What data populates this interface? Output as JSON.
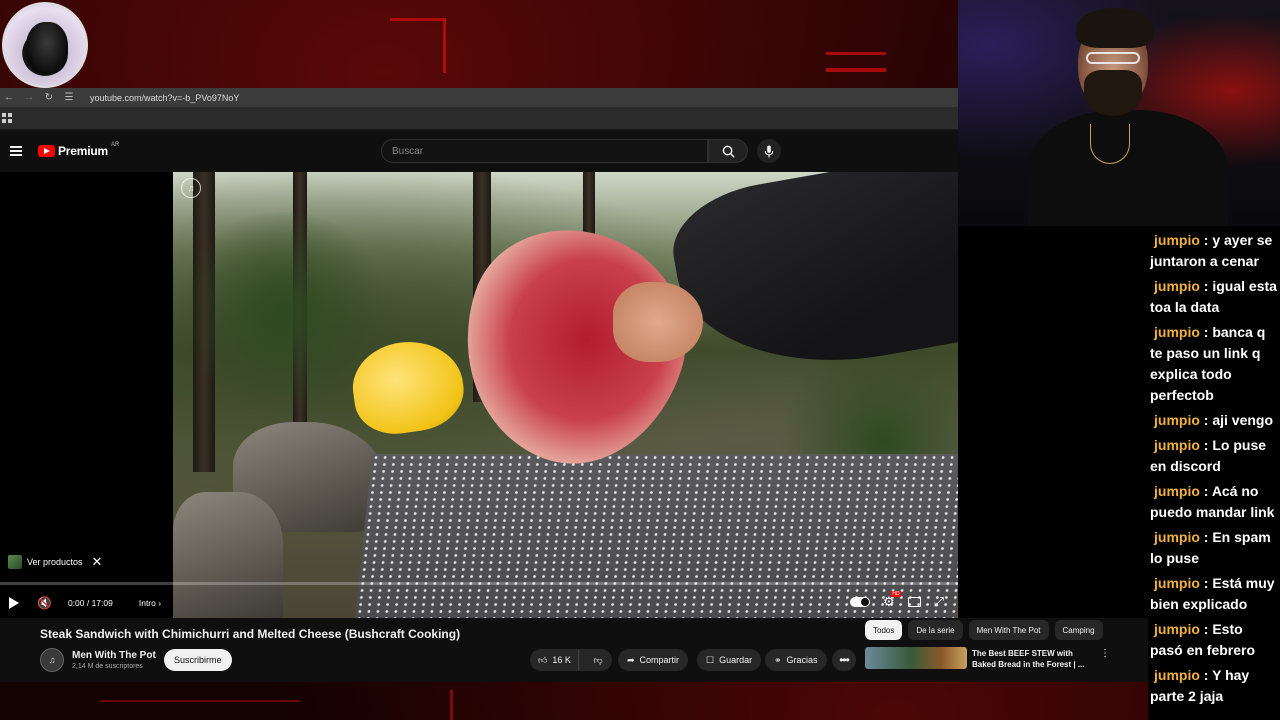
{
  "browser": {
    "url": "youtube.com/watch?v=-b_PVo97NoY"
  },
  "youtube": {
    "logo_text": "Premium",
    "region": "AR",
    "search_placeholder": "Buscar"
  },
  "player": {
    "products_label": "Ver productos",
    "time": "0:00 / 17:09",
    "chapter": "Intro",
    "progress": 0.0,
    "autoplay_on": true
  },
  "video": {
    "title": "Steak Sandwich with Chimichurri and Melted Cheese (Bushcraft Cooking)",
    "channel_name": "Men With The Pot",
    "subscribers": "2,14 M de suscriptores",
    "subscribe_label": "Suscribirme",
    "likes": "16 K",
    "share_label": "Compartir",
    "save_label": "Guardar",
    "thanks_label": "Gracias"
  },
  "recommendations": {
    "chips": [
      "Todos",
      "De la serie",
      "Men With The Pot",
      "Camping"
    ],
    "first_title": "The Best BEEF STEW with Baked Bread in the Forest | ..."
  },
  "chat": {
    "messages": [
      {
        "user": "jumpio",
        "text": "y ayer se juntaron a cenar"
      },
      {
        "user": "jumpio",
        "text": "igual esta toa la data"
      },
      {
        "user": "jumpio",
        "text": "banca q te paso un link q explica todo perfectob"
      },
      {
        "user": "jumpio",
        "text": "aji vengo"
      },
      {
        "user": "jumpio",
        "text": "Lo puse en discord"
      },
      {
        "user": "jumpio",
        "text": "Acá no puedo mandar link"
      },
      {
        "user": "jumpio",
        "text": "En spam lo puse"
      },
      {
        "user": "jumpio",
        "text": "Está muy bien explicado"
      },
      {
        "user": "jumpio",
        "text": "Esto pasó en febrero"
      },
      {
        "user": "jumpio",
        "text": "Y hay parte 2 jaja"
      }
    ]
  },
  "colors": {
    "accent": "#ff0000",
    "chat_username": "#f0b13c",
    "stream_frame": "#c40c0c"
  }
}
